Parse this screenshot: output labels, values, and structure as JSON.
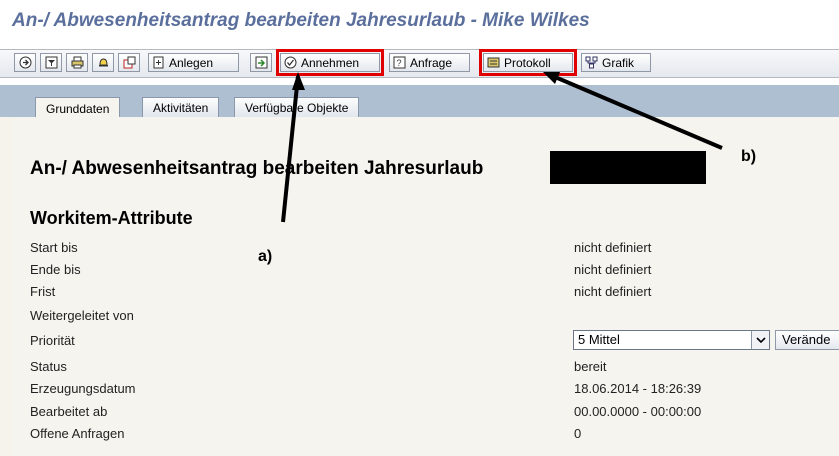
{
  "window": {
    "title": "An-/ Abwesenheitsantrag bearbeiten Jahresurlaub - Mike Wilkes"
  },
  "toolbar": {
    "buttons": [
      {
        "id": "execute",
        "label": "",
        "icon": "execute-icon"
      },
      {
        "id": "display",
        "label": "",
        "icon": "filter-icon"
      },
      {
        "id": "print",
        "label": "",
        "icon": "printer-icon"
      },
      {
        "id": "notify",
        "label": "",
        "icon": "bell-icon"
      },
      {
        "id": "attach",
        "label": "",
        "icon": "attachment-icon"
      },
      {
        "id": "create",
        "label": "Anlegen",
        "icon": "create-icon"
      },
      {
        "id": "forward",
        "label": "",
        "icon": "forward-icon"
      },
      {
        "id": "accept",
        "label": "Annehmen",
        "icon": "accept-icon"
      },
      {
        "id": "request",
        "label": "Anfrage",
        "icon": "request-icon"
      },
      {
        "id": "log",
        "label": "Protokoll",
        "icon": "log-icon"
      },
      {
        "id": "chart",
        "label": "Grafik",
        "icon": "graphic-icon"
      }
    ],
    "highlight_color": "#e00000"
  },
  "tabs": [
    {
      "label": "Grunddaten",
      "active": true
    },
    {
      "label": "Aktivitäten",
      "active": false
    },
    {
      "label": "Verfügbare Objekte",
      "active": false
    }
  ],
  "main": {
    "heading": "An-/ Abwesenheitsantrag bearbeiten Jahresurlaub",
    "attributes_heading": "Workitem-Attribute",
    "attributes": [
      {
        "label": "Start bis",
        "value": "nicht definiert"
      },
      {
        "label": "Ende bis",
        "value": "nicht definiert"
      },
      {
        "label": "Frist",
        "value": "nicht definiert"
      },
      {
        "label": "Weitergeleitet von",
        "value": ""
      },
      {
        "label": "Priorität",
        "value": ""
      },
      {
        "label": "Status",
        "value": "bereit"
      },
      {
        "label": "Erzeugungsdatum",
        "value": "18.06.2014 - 18:26:39"
      },
      {
        "label": "Bearbeitet ab",
        "value": "00.00.0000 - 00:00:00"
      },
      {
        "label": "Offene Anfragen",
        "value": "0"
      }
    ],
    "priority_select": {
      "value": "5 Mittel"
    },
    "change_button": "Verände"
  },
  "annotations": {
    "a": "a)",
    "b": "b)"
  }
}
